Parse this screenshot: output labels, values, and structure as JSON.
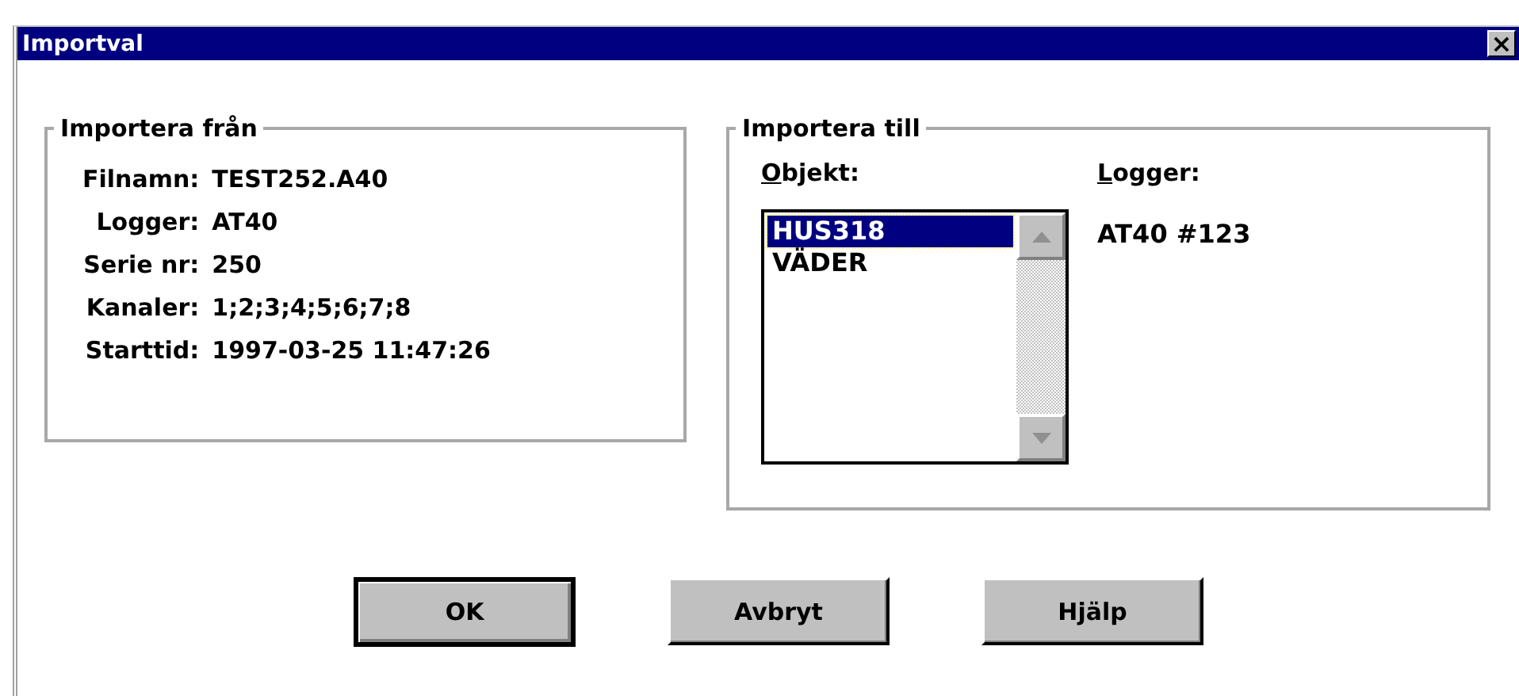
{
  "window": {
    "title": "Importval",
    "close_button": "×"
  },
  "import_from": {
    "legend": "Importera från",
    "fields": [
      {
        "label": "Filnamn:",
        "value": "TEST252.A40"
      },
      {
        "label": "Logger:",
        "value": "AT40"
      },
      {
        "label": "Serie nr:",
        "value": "250"
      },
      {
        "label": "Kanaler:",
        "value": "1;2;3;4;5;6;7;8"
      },
      {
        "label": "Starttid:",
        "value": "1997-03-25 11:47:26"
      }
    ]
  },
  "import_to": {
    "legend": "Importera till",
    "object_label": {
      "text": "Objekt:",
      "underline_first": true
    },
    "logger_label": {
      "text": "Logger:",
      "underline_first": true
    },
    "objects": [
      {
        "text": "HUS318",
        "selected": true
      },
      {
        "text": "VÄDER",
        "selected": false
      }
    ],
    "logger_value": "AT40 #123"
  },
  "buttons": [
    {
      "label": "OK",
      "default": true
    },
    {
      "label": "Avbryt",
      "default": false
    },
    {
      "label": "Hjälp",
      "default": false
    }
  ]
}
